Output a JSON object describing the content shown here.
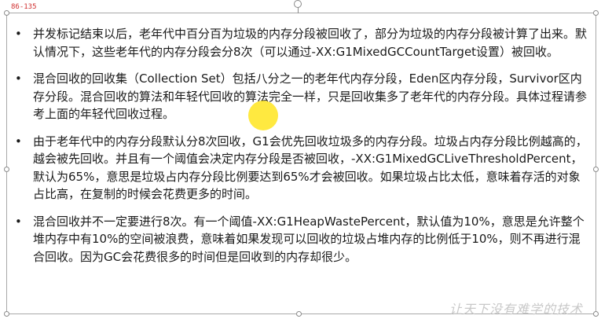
{
  "slide_tag": "86-135",
  "bullets": [
    "并发标记结束以后，老年代中百分百为垃圾的内存分段被回收了，部分为垃圾的内存分段被计算了出来。默认情况下，这些老年代的内存分段会分8次（可以通过-XX:G1MixedGCCountTarget设置）被回收。",
    "混合回收的回收集（Collection Set）包括八分之一的老年代内存分段，Eden区内存分段，Survivor区内存分段。混合回收的算法和年轻代回收的算法完全一样，只是回收集多了老年代的内存分段。具体过程请参考上面的年轻代回收过程。",
    "由于老年代中的内存分段默认分8次回收，G1会优先回收垃圾多的内存分段。垃圾占内存分段比例越高的，越会被先回收。并且有一个阈值会决定内存分段是否被回收，-XX:G1MixedGCLiveThresholdPercent，默认为65%，意思是垃圾占内存分段比例要达到65%才会被回收。如果垃圾占比太低，意味着存活的对象占比高，在复制的时候会花费更多的时间。",
    "混合回收并不一定要进行8次。有一个阈值-XX:G1HeapWastePercent，默认值为10%，意思是允许整个堆内存中有10%的空间被浪费，意味着如果发现可以回收的垃圾占堆内存的比例低于10%，则不再进行混合回收。因为GC会花费很多的时间但是回收到的内存却很少。"
  ],
  "bullet_symbol": "•",
  "watermark_text": "让天下没有难学的技术",
  "colors": {
    "highlight": "#ffe200",
    "tag": "#d03030",
    "frame": "#a8a8a8"
  }
}
